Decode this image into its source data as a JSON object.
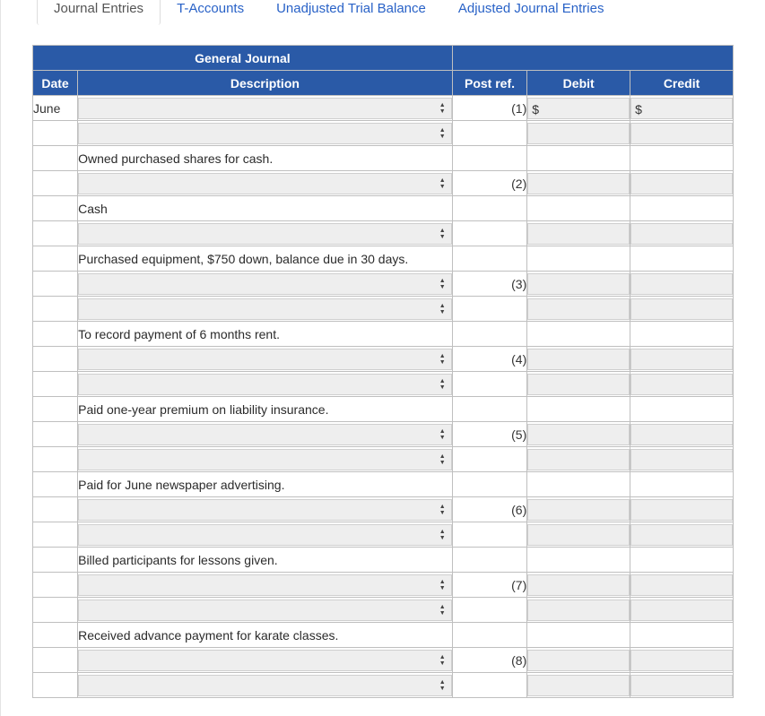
{
  "tabs": {
    "journal": "Journal Entries",
    "taccounts": "T-Accounts",
    "unadjusted": "Unadjusted Trial Balance",
    "adjusted": "Adjusted Journal Entries"
  },
  "journal": {
    "title": "General Journal",
    "headers": {
      "date": "Date",
      "description": "Description",
      "postref": "Post ref.",
      "debit": "Debit",
      "credit": "Credit"
    },
    "rows": [
      {
        "date": "June",
        "type": "select",
        "postref": "(1)",
        "debit": "$",
        "credit": "$"
      },
      {
        "date": "",
        "type": "select",
        "postref": "",
        "debit_editable": true,
        "credit_editable": true
      },
      {
        "date": "",
        "type": "text",
        "text": "Owned purchased shares for cash."
      },
      {
        "date": "",
        "type": "select",
        "postref": "(2)",
        "debit_editable": true,
        "credit_editable": true
      },
      {
        "date": "",
        "type": "indent",
        "text": "Cash"
      },
      {
        "date": "",
        "type": "select",
        "postref": "",
        "debit_editable": true,
        "credit_editable": true
      },
      {
        "date": "",
        "type": "text",
        "text": "Purchased equipment, $750 down, balance due in 30 days."
      },
      {
        "date": "",
        "type": "select",
        "postref": "(3)",
        "debit_editable": true,
        "credit_editable": true
      },
      {
        "date": "",
        "type": "select",
        "postref": "",
        "debit_editable": true,
        "credit_editable": true
      },
      {
        "date": "",
        "type": "text",
        "text": "To record payment of 6 months rent."
      },
      {
        "date": "",
        "type": "select",
        "postref": "(4)",
        "debit_editable": true,
        "credit_editable": true
      },
      {
        "date": "",
        "type": "select",
        "postref": "",
        "debit_editable": true,
        "credit_editable": true
      },
      {
        "date": "",
        "type": "text",
        "text": "Paid one-year premium on liability insurance."
      },
      {
        "date": "",
        "type": "select",
        "postref": "(5)",
        "debit_editable": true,
        "credit_editable": true
      },
      {
        "date": "",
        "type": "select",
        "postref": "",
        "debit_editable": true,
        "credit_editable": true
      },
      {
        "date": "",
        "type": "text",
        "text": "Paid for June newspaper advertising."
      },
      {
        "date": "",
        "type": "select",
        "postref": "(6)",
        "debit_editable": true,
        "credit_editable": true
      },
      {
        "date": "",
        "type": "select",
        "postref": "",
        "debit_editable": true,
        "credit_editable": true
      },
      {
        "date": "",
        "type": "text",
        "text": "Billed participants for lessons given."
      },
      {
        "date": "",
        "type": "select",
        "postref": "(7)",
        "debit_editable": true,
        "credit_editable": true
      },
      {
        "date": "",
        "type": "select",
        "postref": "",
        "debit_editable": true,
        "credit_editable": true
      },
      {
        "date": "",
        "type": "text",
        "text": "Received advance payment for karate classes."
      },
      {
        "date": "",
        "type": "select",
        "postref": "(8)",
        "debit_editable": true,
        "credit_editable": true
      },
      {
        "date": "",
        "type": "select",
        "postref": "",
        "debit_editable": true,
        "credit_editable": true
      }
    ]
  }
}
